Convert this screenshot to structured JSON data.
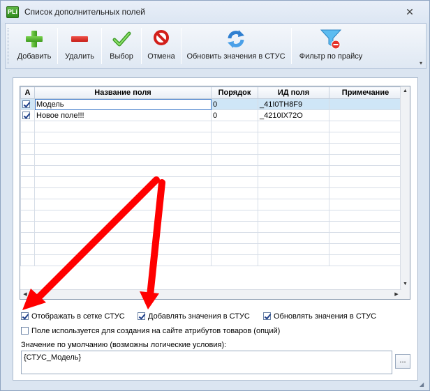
{
  "window": {
    "app_icon_text": "PLi",
    "title": "Список дополнительных полей",
    "close_glyph": "✕"
  },
  "toolbar": {
    "buttons": [
      {
        "label": "Добавить",
        "icon": "plus-icon"
      },
      {
        "label": "Удалить",
        "icon": "minus-icon"
      },
      {
        "label": "Выбор",
        "icon": "checkmark-icon"
      },
      {
        "label": "Отмена",
        "icon": "cancel-icon"
      },
      {
        "label": "Обновить значения в СТУС",
        "icon": "refresh-icon"
      },
      {
        "label": "Фильтр по прайсу",
        "icon": "funnel-icon"
      }
    ]
  },
  "grid": {
    "columns": [
      "А",
      "Название поля",
      "Порядок",
      "ИД поля",
      "Примечание"
    ],
    "rows": [
      {
        "active": true,
        "name": "Модель",
        "order": "0",
        "id": "_41I0TH8F9",
        "note": "",
        "selected": true
      },
      {
        "active": true,
        "name": "Новое поле!!!",
        "order": "0",
        "id": "_4210IX72O",
        "note": "",
        "selected": false
      }
    ]
  },
  "options": {
    "show_in_grid": {
      "label": "Отображать в сетке СТУС",
      "checked": true
    },
    "add_values": {
      "label": "Добавлять значения в СТУС",
      "checked": true
    },
    "update_values": {
      "label": "Обновлять значения в СТУС",
      "checked": true
    },
    "use_for_attributes": {
      "label": "Поле используется для создания на сайте атрибутов товаров (опций)",
      "checked": false
    }
  },
  "default_value": {
    "label": "Значение по умолчанию (возможны логические условия):",
    "value": "{СТУС_Модель}",
    "browse_label": "..."
  },
  "colors": {
    "accent": "#3b78c8",
    "selection": "#cfe6f7",
    "annotation_arrow": "#ff0000"
  }
}
